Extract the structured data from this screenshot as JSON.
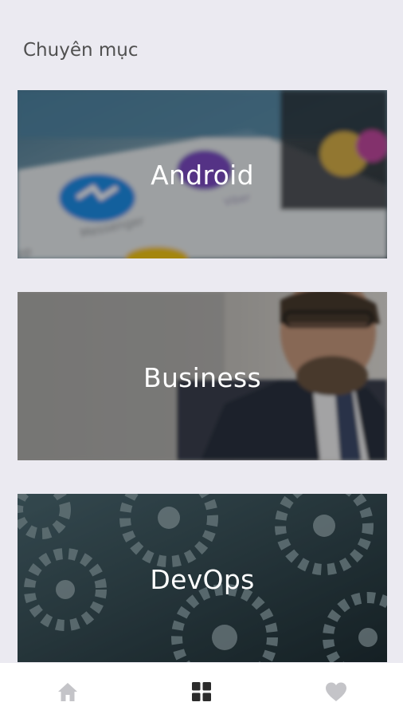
{
  "header": {
    "title": "Chuyên mục"
  },
  "categories": [
    {
      "label": "Android",
      "icon": "android-photo"
    },
    {
      "label": "Business",
      "icon": "business-photo"
    },
    {
      "label": "DevOps",
      "icon": "gears-photo"
    }
  ],
  "bottom_nav": {
    "items": [
      {
        "name": "home",
        "icon": "home-icon",
        "active": false
      },
      {
        "name": "categories",
        "icon": "grid-icon",
        "active": true
      },
      {
        "name": "favorites",
        "icon": "heart-icon",
        "active": false
      }
    ]
  },
  "colors": {
    "background": "#ebeaf1",
    "nav_active": "#2b2b2b",
    "nav_inactive": "#c4c4c8",
    "title_text": "#505050",
    "card_text": "#ffffff"
  }
}
